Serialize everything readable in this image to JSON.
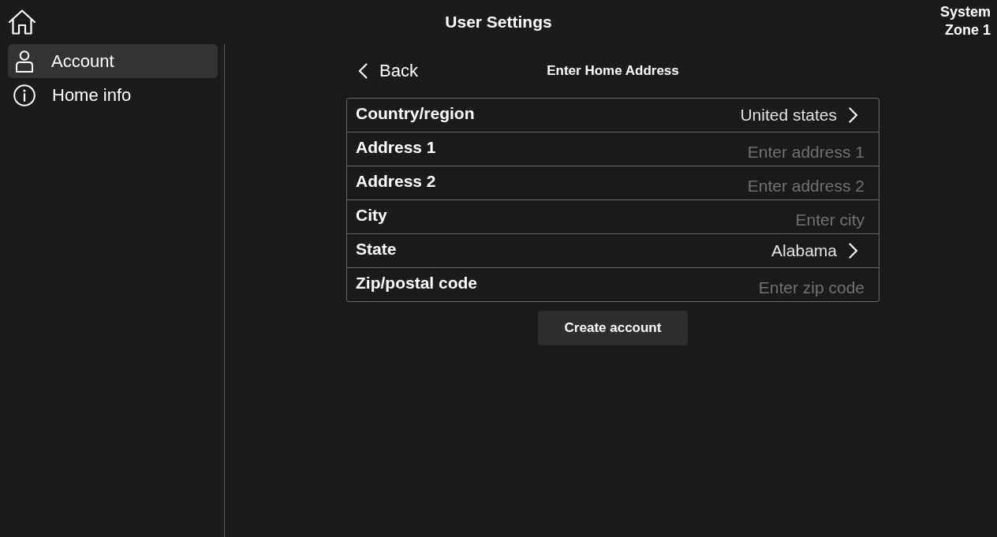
{
  "header": {
    "title": "User Settings",
    "zone_lines": [
      "System",
      "Zone 1"
    ]
  },
  "sidebar": {
    "items": [
      {
        "kind": "profile",
        "label": "Account",
        "selected": true
      },
      {
        "kind": "info",
        "label": "Home info",
        "selected": false
      }
    ]
  },
  "page": {
    "back_label": "Back",
    "title": "Enter Home Address"
  },
  "form": {
    "rows": [
      {
        "kind": "select",
        "label": "Country/region",
        "value": "United states"
      },
      {
        "kind": "input",
        "label": "Address 1",
        "placeholder": "Enter address 1"
      },
      {
        "kind": "input",
        "label": "Address 2",
        "placeholder": "Enter address 2"
      },
      {
        "kind": "input",
        "label": "City",
        "placeholder": "Enter city"
      },
      {
        "kind": "select",
        "label": "State",
        "value": "Alabama"
      },
      {
        "kind": "input",
        "label": "Zip/postal code",
        "placeholder": "Enter zip code"
      }
    ]
  },
  "submit_button": "Create account"
}
